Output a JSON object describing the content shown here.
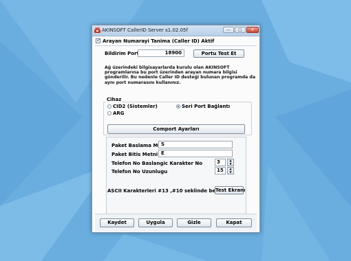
{
  "window": {
    "title": "AKINSOFT CallerID Server s1.02.05f"
  },
  "top_checkbox": {
    "label": "Arayan Numarayi Tanima (Caller ID) Aktif",
    "checked": true
  },
  "notification": {
    "label": "Bildirim Portu",
    "value": "18900",
    "test_button": "Portu Test Et"
  },
  "description": "Ağ üzerindeki bilgisayarlarda kurulu olan AKINSOFT programlarına bu port üzerinden arayan numara bilgisi gönderilir. Bu nedenle Caller ID desteği bulunan programda da aynı port numarasını kullanınız.",
  "device": {
    "title": "Cihaz",
    "options": [
      "CID2 (Sistemler)",
      "Seri Port Bağlantı",
      "ARG"
    ],
    "selected": "Seri Port Bağlantı"
  },
  "comport": {
    "button": "Comport Ayarları",
    "start_text_label": "Paket Baslama Metni",
    "start_text_value": "S",
    "end_text_label": "Paket Bitis Metni",
    "end_text_value": "E",
    "phone_start_label": "Telefon No Baslangic Karakter No",
    "phone_start_value": "3",
    "phone_length_label": "Telefon No Uzunlugu",
    "phone_length_value": "15",
    "ascii_note": "ASCII Karakterleri #13 ,#10 seklinde belirtiniz.",
    "test_screen_button": "Test Ekranı"
  },
  "footer": {
    "save": "Kaydet",
    "apply": "Uygula",
    "hide": "Gizle",
    "close": "Kapat"
  },
  "colors": {
    "desktop": "#6aaee0",
    "title_close": "#c8452c",
    "accent": "#234b8a"
  }
}
